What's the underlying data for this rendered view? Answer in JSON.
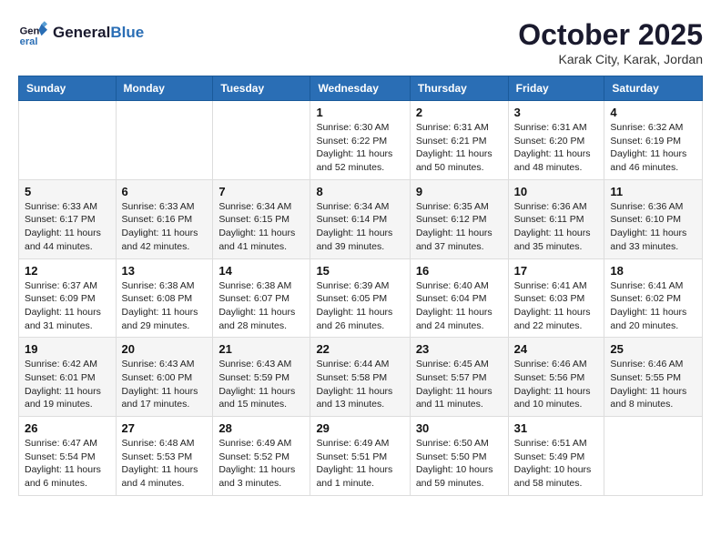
{
  "header": {
    "logo_line1": "General",
    "logo_line2": "Blue",
    "month": "October 2025",
    "location": "Karak City, Karak, Jordan"
  },
  "weekdays": [
    "Sunday",
    "Monday",
    "Tuesday",
    "Wednesday",
    "Thursday",
    "Friday",
    "Saturday"
  ],
  "weeks": [
    [
      {
        "day": "",
        "info": ""
      },
      {
        "day": "",
        "info": ""
      },
      {
        "day": "",
        "info": ""
      },
      {
        "day": "1",
        "info": "Sunrise: 6:30 AM\nSunset: 6:22 PM\nDaylight: 11 hours\nand 52 minutes."
      },
      {
        "day": "2",
        "info": "Sunrise: 6:31 AM\nSunset: 6:21 PM\nDaylight: 11 hours\nand 50 minutes."
      },
      {
        "day": "3",
        "info": "Sunrise: 6:31 AM\nSunset: 6:20 PM\nDaylight: 11 hours\nand 48 minutes."
      },
      {
        "day": "4",
        "info": "Sunrise: 6:32 AM\nSunset: 6:19 PM\nDaylight: 11 hours\nand 46 minutes."
      }
    ],
    [
      {
        "day": "5",
        "info": "Sunrise: 6:33 AM\nSunset: 6:17 PM\nDaylight: 11 hours\nand 44 minutes."
      },
      {
        "day": "6",
        "info": "Sunrise: 6:33 AM\nSunset: 6:16 PM\nDaylight: 11 hours\nand 42 minutes."
      },
      {
        "day": "7",
        "info": "Sunrise: 6:34 AM\nSunset: 6:15 PM\nDaylight: 11 hours\nand 41 minutes."
      },
      {
        "day": "8",
        "info": "Sunrise: 6:34 AM\nSunset: 6:14 PM\nDaylight: 11 hours\nand 39 minutes."
      },
      {
        "day": "9",
        "info": "Sunrise: 6:35 AM\nSunset: 6:12 PM\nDaylight: 11 hours\nand 37 minutes."
      },
      {
        "day": "10",
        "info": "Sunrise: 6:36 AM\nSunset: 6:11 PM\nDaylight: 11 hours\nand 35 minutes."
      },
      {
        "day": "11",
        "info": "Sunrise: 6:36 AM\nSunset: 6:10 PM\nDaylight: 11 hours\nand 33 minutes."
      }
    ],
    [
      {
        "day": "12",
        "info": "Sunrise: 6:37 AM\nSunset: 6:09 PM\nDaylight: 11 hours\nand 31 minutes."
      },
      {
        "day": "13",
        "info": "Sunrise: 6:38 AM\nSunset: 6:08 PM\nDaylight: 11 hours\nand 29 minutes."
      },
      {
        "day": "14",
        "info": "Sunrise: 6:38 AM\nSunset: 6:07 PM\nDaylight: 11 hours\nand 28 minutes."
      },
      {
        "day": "15",
        "info": "Sunrise: 6:39 AM\nSunset: 6:05 PM\nDaylight: 11 hours\nand 26 minutes."
      },
      {
        "day": "16",
        "info": "Sunrise: 6:40 AM\nSunset: 6:04 PM\nDaylight: 11 hours\nand 24 minutes."
      },
      {
        "day": "17",
        "info": "Sunrise: 6:41 AM\nSunset: 6:03 PM\nDaylight: 11 hours\nand 22 minutes."
      },
      {
        "day": "18",
        "info": "Sunrise: 6:41 AM\nSunset: 6:02 PM\nDaylight: 11 hours\nand 20 minutes."
      }
    ],
    [
      {
        "day": "19",
        "info": "Sunrise: 6:42 AM\nSunset: 6:01 PM\nDaylight: 11 hours\nand 19 minutes."
      },
      {
        "day": "20",
        "info": "Sunrise: 6:43 AM\nSunset: 6:00 PM\nDaylight: 11 hours\nand 17 minutes."
      },
      {
        "day": "21",
        "info": "Sunrise: 6:43 AM\nSunset: 5:59 PM\nDaylight: 11 hours\nand 15 minutes."
      },
      {
        "day": "22",
        "info": "Sunrise: 6:44 AM\nSunset: 5:58 PM\nDaylight: 11 hours\nand 13 minutes."
      },
      {
        "day": "23",
        "info": "Sunrise: 6:45 AM\nSunset: 5:57 PM\nDaylight: 11 hours\nand 11 minutes."
      },
      {
        "day": "24",
        "info": "Sunrise: 6:46 AM\nSunset: 5:56 PM\nDaylight: 11 hours\nand 10 minutes."
      },
      {
        "day": "25",
        "info": "Sunrise: 6:46 AM\nSunset: 5:55 PM\nDaylight: 11 hours\nand 8 minutes."
      }
    ],
    [
      {
        "day": "26",
        "info": "Sunrise: 6:47 AM\nSunset: 5:54 PM\nDaylight: 11 hours\nand 6 minutes."
      },
      {
        "day": "27",
        "info": "Sunrise: 6:48 AM\nSunset: 5:53 PM\nDaylight: 11 hours\nand 4 minutes."
      },
      {
        "day": "28",
        "info": "Sunrise: 6:49 AM\nSunset: 5:52 PM\nDaylight: 11 hours\nand 3 minutes."
      },
      {
        "day": "29",
        "info": "Sunrise: 6:49 AM\nSunset: 5:51 PM\nDaylight: 11 hours\nand 1 minute."
      },
      {
        "day": "30",
        "info": "Sunrise: 6:50 AM\nSunset: 5:50 PM\nDaylight: 10 hours\nand 59 minutes."
      },
      {
        "day": "31",
        "info": "Sunrise: 6:51 AM\nSunset: 5:49 PM\nDaylight: 10 hours\nand 58 minutes."
      },
      {
        "day": "",
        "info": ""
      }
    ]
  ]
}
